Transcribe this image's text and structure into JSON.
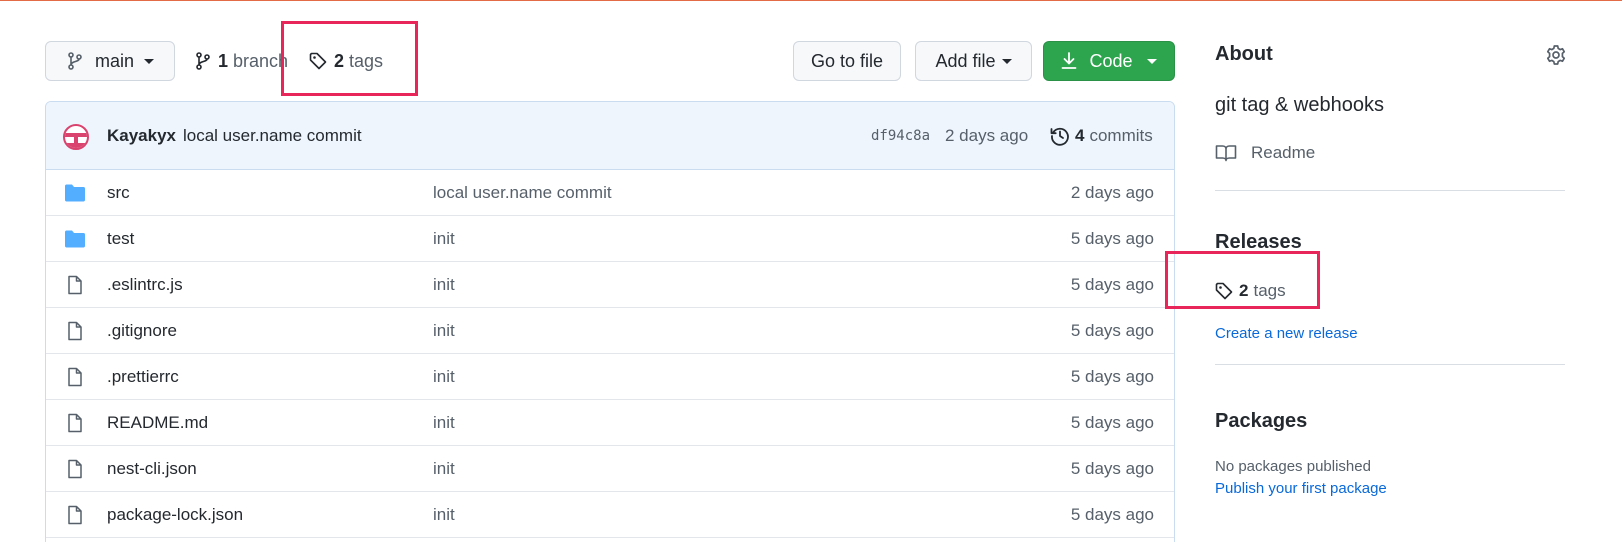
{
  "toolbar": {
    "branch_name": "main",
    "branch_count": "1",
    "branch_label": "branch",
    "tag_count": "2",
    "tag_label": "tags",
    "goto_file": "Go to file",
    "add_file": "Add file",
    "code": "Code"
  },
  "commit": {
    "author": "Kayakyx",
    "message": "local user.name commit",
    "sha": "df94c8a",
    "age": "2 days ago",
    "count": "4",
    "count_label": "commits"
  },
  "files": [
    {
      "type": "folder",
      "name": "src",
      "message": "local user.name commit",
      "age": "2 days ago"
    },
    {
      "type": "folder",
      "name": "test",
      "message": "init",
      "age": "5 days ago"
    },
    {
      "type": "file",
      "name": ".eslintrc.js",
      "message": "init",
      "age": "5 days ago"
    },
    {
      "type": "file",
      "name": ".gitignore",
      "message": "init",
      "age": "5 days ago"
    },
    {
      "type": "file",
      "name": ".prettierrc",
      "message": "init",
      "age": "5 days ago"
    },
    {
      "type": "file",
      "name": "README.md",
      "message": "init",
      "age": "5 days ago"
    },
    {
      "type": "file",
      "name": "nest-cli.json",
      "message": "init",
      "age": "5 days ago"
    },
    {
      "type": "file",
      "name": "package-lock.json",
      "message": "init",
      "age": "5 days ago"
    }
  ],
  "sidebar": {
    "about_title": "About",
    "about_description": "git tag & webhooks",
    "readme_label": "Readme",
    "releases_title": "Releases",
    "releases_tag_count": "2",
    "releases_tag_label": "tags",
    "create_release": "Create a new release",
    "packages_title": "Packages",
    "no_packages": "No packages published",
    "publish_package": "Publish your first package"
  },
  "colors": {
    "highlight": "#e8265a",
    "code_button": "#2da44e",
    "link": "#0969da",
    "folder": "#54aeff"
  }
}
